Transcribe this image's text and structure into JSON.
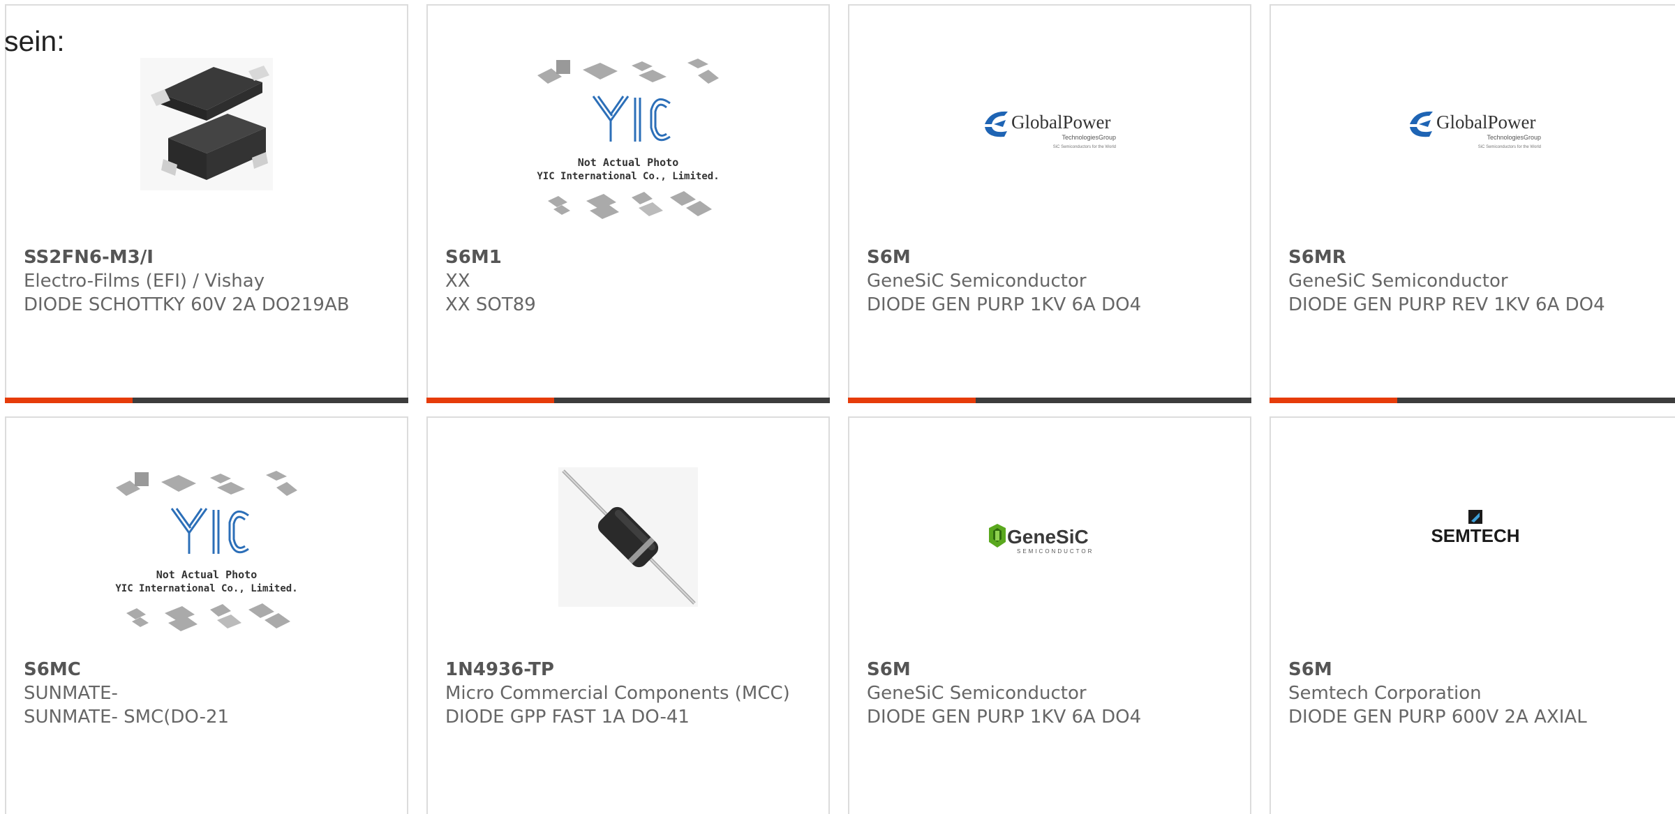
{
  "lead_text": "sein:",
  "colors": {
    "accent": "#e63c0a",
    "bar": "#3d3d3d",
    "border": "#dcdcdc"
  },
  "products": [
    {
      "part_number": "SS2FN6-M3/I",
      "manufacturer": "Electro-Films (EFI) / Vishay",
      "description": "DIODE SCHOTTKY 60V 2A DO219AB",
      "image": "smd-diode-package"
    },
    {
      "part_number": "S6M1",
      "manufacturer": "XX",
      "description": "XX SOT89",
      "image": "yic-not-actual-photo"
    },
    {
      "part_number": "S6M",
      "manufacturer": "GeneSiC Semiconductor",
      "description": "DIODE GEN PURP 1KV 6A DO4",
      "image": "globalpower-logo"
    },
    {
      "part_number": "S6MR",
      "manufacturer": "GeneSiC Semiconductor",
      "description": "DIODE GEN PURP REV 1KV 6A DO4",
      "image": "globalpower-logo"
    },
    {
      "part_number": "S6MC",
      "manufacturer": "SUNMATE-",
      "description": "SUNMATE- SMC(DO-21",
      "image": "yic-not-actual-photo"
    },
    {
      "part_number": "1N4936-TP",
      "manufacturer": "Micro Commercial Components (MCC)",
      "description": "DIODE GPP FAST 1A DO-41",
      "image": "axial-diode"
    },
    {
      "part_number": "S6M",
      "manufacturer": "GeneSiC Semiconductor",
      "description": "DIODE GEN PURP 1KV 6A DO4",
      "image": "genesic-logo"
    },
    {
      "part_number": "S6M",
      "manufacturer": "Semtech Corporation",
      "description": "DIODE GEN PURP 600V 2A AXIAL",
      "image": "semtech-logo"
    }
  ],
  "image_text": {
    "yic_brand": "YIC",
    "yic_line1": "Not Actual Photo",
    "yic_line2": "YIC International Co., Limited.",
    "globalpower_name": "GlobalPower",
    "globalpower_sub": "TechnologiesGroup",
    "globalpower_tag": "SiC Semiconductors for the World",
    "genesic_name": "GeneSiC",
    "genesic_sub": "SEMICONDUCTOR",
    "semtech_name": "SEMTECH"
  }
}
